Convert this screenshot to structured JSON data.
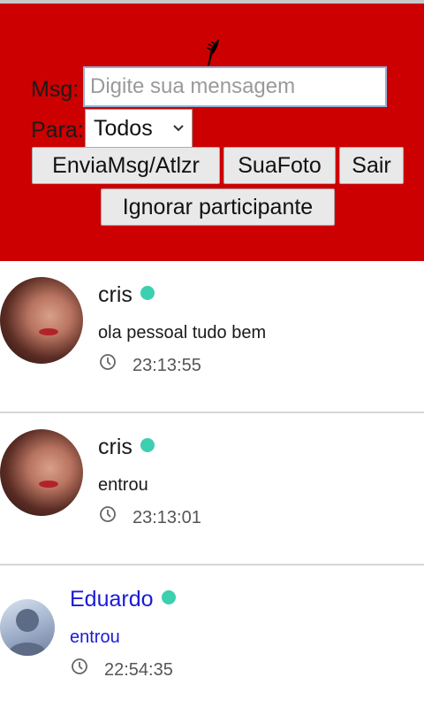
{
  "form": {
    "msg_label": "Msg:",
    "msg_placeholder": "Digite sua mensagem",
    "to_label": "Para:",
    "to_selected": "Todos"
  },
  "buttons": {
    "send": "EnviaMsg/Atlzr",
    "photo": "SuaFoto",
    "exit": "Sair",
    "ignore": "Ignorar participante"
  },
  "messages": [
    {
      "name": "cris",
      "text": "ola pessoal tudo bem",
      "time": "23:13:55",
      "online": true,
      "avatar": "photo"
    },
    {
      "name": "cris",
      "text": "entrou",
      "time": "23:13:01",
      "online": true,
      "avatar": "photo"
    },
    {
      "name": "Eduardo",
      "text": "entrou",
      "time": "22:54:35",
      "online": true,
      "avatar": "default"
    }
  ],
  "colors": {
    "header_bg": "#cc0000",
    "online_dot": "#3ccfb0",
    "name_link_blue": "#1a1adb"
  }
}
